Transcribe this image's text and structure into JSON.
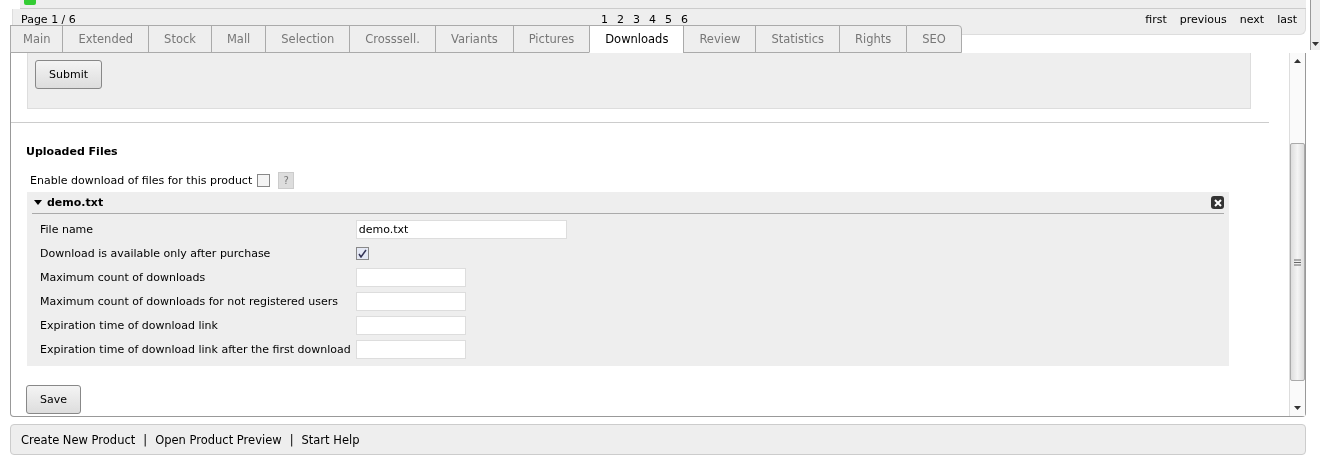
{
  "pagination": {
    "page_label": "Page 1 / 6",
    "pages": [
      "1",
      "2",
      "3",
      "4",
      "5",
      "6"
    ],
    "nav": [
      "first",
      "previous",
      "next",
      "last"
    ]
  },
  "tabs": [
    {
      "label": "Main",
      "selected": false
    },
    {
      "label": "Extended",
      "selected": false
    },
    {
      "label": "Stock",
      "selected": false
    },
    {
      "label": "Mall",
      "selected": false
    },
    {
      "label": "Selection",
      "selected": false
    },
    {
      "label": "Crosssell.",
      "selected": false
    },
    {
      "label": "Variants",
      "selected": false
    },
    {
      "label": "Pictures",
      "selected": false
    },
    {
      "label": "Downloads",
      "selected": true
    },
    {
      "label": "Review",
      "selected": false
    },
    {
      "label": "Statistics",
      "selected": false
    },
    {
      "label": "Rights",
      "selected": false
    },
    {
      "label": "SEO",
      "selected": false
    }
  ],
  "submit_button": "Submit",
  "uploaded_files": {
    "heading": "Uploaded Files",
    "enable_label": "Enable download of files for this product",
    "enable_checked": false,
    "help": "?",
    "file": {
      "name": "demo.txt",
      "expanded": true,
      "fields": [
        {
          "kind": "text",
          "label": "File name",
          "value": "demo.txt",
          "wide": true
        },
        {
          "kind": "checkbox",
          "label": "Download is available only after purchase",
          "checked": true
        },
        {
          "kind": "text",
          "label": "Maximum count of downloads"
        },
        {
          "kind": "text",
          "label": "Maximum count of downloads for not registered users"
        },
        {
          "kind": "text",
          "label": "Expiration time of download link"
        },
        {
          "kind": "text",
          "label": "Expiration time of download link after the first download"
        }
      ]
    }
  },
  "save_button": "Save",
  "footer_links": [
    "Create New Product",
    "Open Product Preview",
    "Start Help"
  ],
  "footer_separator": "|"
}
